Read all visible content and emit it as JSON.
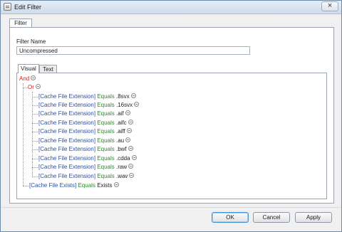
{
  "window": {
    "title": "Edit Filter"
  },
  "tabs": {
    "outer": "Filter",
    "visual": "Visual",
    "text": "Text"
  },
  "form": {
    "filter_name_label": "Filter Name",
    "filter_name_value": "Uncompressed"
  },
  "tree": {
    "root_op": "And",
    "group_op": "Or",
    "rules": [
      {
        "field": "[Cache File Extension]",
        "op": "Equals",
        "value": ".8svx"
      },
      {
        "field": "[Cache File Extension]",
        "op": "Equals",
        "value": ".16svx"
      },
      {
        "field": "[Cache File Extension]",
        "op": "Equals",
        "value": ".aif"
      },
      {
        "field": "[Cache File Extension]",
        "op": "Equals",
        "value": ".aifc"
      },
      {
        "field": "[Cache File Extension]",
        "op": "Equals",
        "value": ".aiff"
      },
      {
        "field": "[Cache File Extension]",
        "op": "Equals",
        "value": ".au"
      },
      {
        "field": "[Cache File Extension]",
        "op": "Equals",
        "value": ".bwf"
      },
      {
        "field": "[Cache File Extension]",
        "op": "Equals",
        "value": ".cdda"
      },
      {
        "field": "[Cache File Extension]",
        "op": "Equals",
        "value": ".raw"
      },
      {
        "field": "[Cache File Extension]",
        "op": "Equals",
        "value": ".wav"
      }
    ],
    "last_rule": {
      "field": "[Cache File Exists]",
      "op": "Equals",
      "value": "Exists"
    }
  },
  "buttons": {
    "ok": "OK",
    "cancel": "Cancel",
    "apply": "Apply"
  }
}
